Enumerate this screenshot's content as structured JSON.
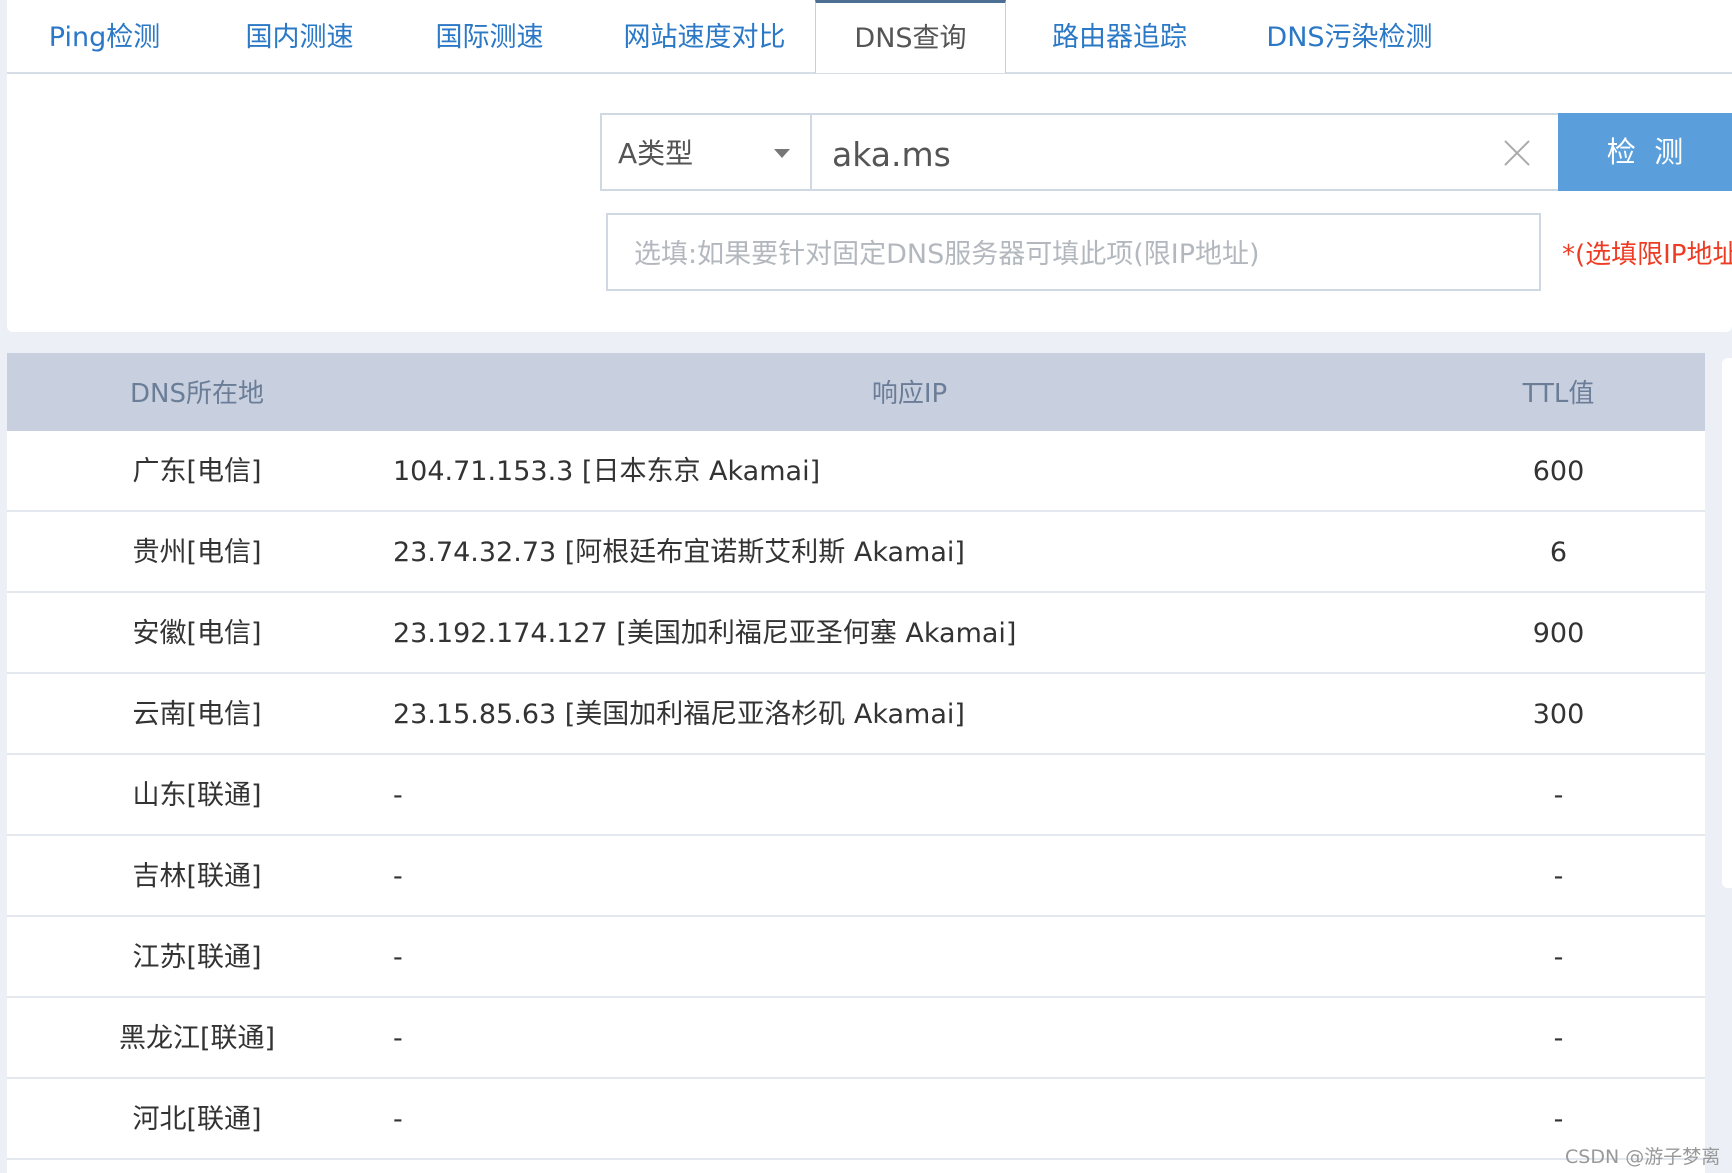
{
  "tabs": [
    {
      "label": "Ping检测",
      "active": false
    },
    {
      "label": "国内测速",
      "active": false
    },
    {
      "label": "国际测速",
      "active": false
    },
    {
      "label": "网站速度对比",
      "active": false
    },
    {
      "label": "DNS查询",
      "active": true
    },
    {
      "label": "路由器追踪",
      "active": false
    },
    {
      "label": "DNS污染检测",
      "active": false
    }
  ],
  "form": {
    "record_type": "A类型",
    "domain_value": "aka.ms",
    "check_button": "检  测",
    "dns_server_placeholder": "选填:如果要针对固定DNS服务器可填此项(限IP地址)",
    "dns_server_value": "",
    "hint": "*(选填限IP地址)"
  },
  "table": {
    "headers": {
      "location": "DNS所在地",
      "ip": "响应IP",
      "ttl": "TTL值"
    },
    "rows": [
      {
        "location": "广东[电信]",
        "ip": "104.71.153.3 [日本东京 Akamai]",
        "ttl": "600"
      },
      {
        "location": "贵州[电信]",
        "ip": "23.74.32.73 [阿根廷布宜诺斯艾利斯 Akamai]",
        "ttl": "6"
      },
      {
        "location": "安徽[电信]",
        "ip": "23.192.174.127 [美国加利福尼亚圣何塞 Akamai]",
        "ttl": "900"
      },
      {
        "location": "云南[电信]",
        "ip": "23.15.85.63 [美国加利福尼亚洛杉矶 Akamai]",
        "ttl": "300"
      },
      {
        "location": "山东[联通]",
        "ip": "-",
        "ttl": "-"
      },
      {
        "location": "吉林[联通]",
        "ip": "-",
        "ttl": "-"
      },
      {
        "location": "江苏[联通]",
        "ip": "-",
        "ttl": "-"
      },
      {
        "location": "黑龙江[联通]",
        "ip": "-",
        "ttl": "-"
      },
      {
        "location": "河北[联通]",
        "ip": "-",
        "ttl": "-"
      }
    ]
  },
  "watermark": "CSDN @游子梦离",
  "colors": {
    "tab_link": "#2a78c6",
    "button": "#5a9fdc",
    "hint": "#ee3b23",
    "header_bg": "#c8d0df"
  }
}
